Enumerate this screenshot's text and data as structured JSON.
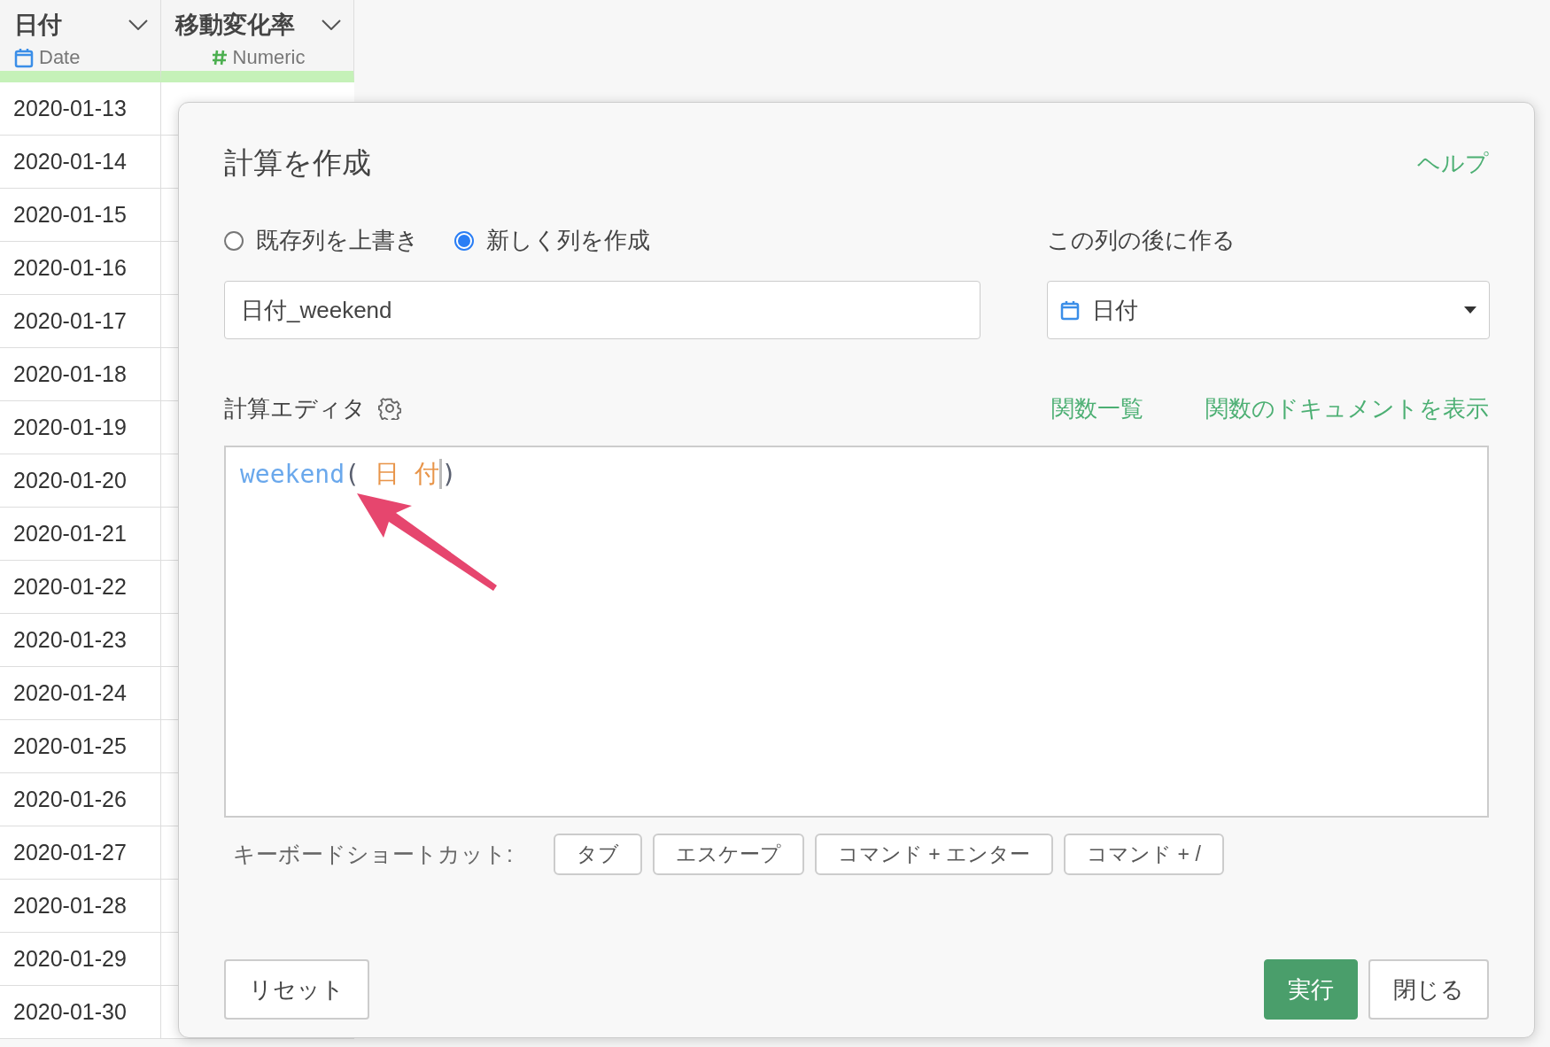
{
  "table": {
    "columns": [
      {
        "name": "日付",
        "kind": "date",
        "type": "Date"
      },
      {
        "name": "移動変化率",
        "kind": "numeric",
        "type": "Numeric"
      }
    ],
    "rows": [
      "2020-01-13",
      "2020-01-14",
      "2020-01-15",
      "2020-01-16",
      "2020-01-17",
      "2020-01-18",
      "2020-01-19",
      "2020-01-20",
      "2020-01-21",
      "2020-01-22",
      "2020-01-23",
      "2020-01-24",
      "2020-01-25",
      "2020-01-26",
      "2020-01-27",
      "2020-01-28",
      "2020-01-29",
      "2020-01-30"
    ]
  },
  "dialog": {
    "title": "計算を作成",
    "help": "ヘルプ",
    "modes": [
      {
        "label": "既存列を上書き",
        "selected": false
      },
      {
        "label": "新しく列を作成",
        "selected": true
      }
    ],
    "name_field": {
      "value": "日付_weekend"
    },
    "position": {
      "label": "この列の後に作る",
      "value": "日付"
    },
    "editor": {
      "label": "計算エディタ",
      "links": [
        "関数一覧",
        "関数のドキュメントを表示"
      ],
      "tokens": [
        {
          "kind": "function",
          "text": "weekend"
        },
        {
          "kind": "punct",
          "text": "( "
        },
        {
          "kind": "column",
          "text": "日 付"
        },
        {
          "kind": "cursor"
        },
        {
          "kind": "punct",
          "text": ")"
        }
      ]
    },
    "shortcuts": {
      "label": "キーボードショートカット:",
      "keys": [
        "タブ",
        "エスケープ",
        "コマンド + エンター",
        "コマンド + /"
      ]
    },
    "buttons": [
      {
        "kind": "secondary",
        "label": "リセット"
      },
      {
        "kind": "primary",
        "label": "実行"
      },
      {
        "kind": "secondary",
        "label": "閉じる"
      }
    ]
  }
}
